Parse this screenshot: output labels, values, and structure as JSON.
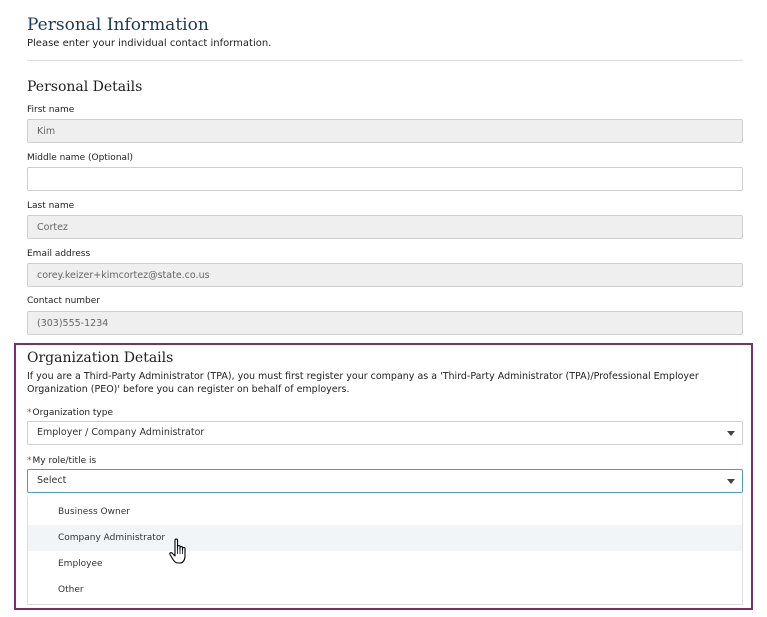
{
  "header": {
    "title": "Personal Information",
    "subtitle": "Please enter your individual contact information."
  },
  "personal": {
    "heading": "Personal Details",
    "first_name": {
      "label": "First name",
      "value": "Kim"
    },
    "middle_name": {
      "label": "Middle name (Optional)",
      "value": ""
    },
    "last_name": {
      "label": "Last name",
      "value": "Cortez"
    },
    "email": {
      "label": "Email address",
      "value": "corey.keizer+kimcortez@state.co.us"
    },
    "contact": {
      "label": "Contact number",
      "value": "(303)555-1234"
    }
  },
  "organization": {
    "heading": "Organization Details",
    "description": "If you are a Third-Party Administrator (TPA), you must first register your company as a 'Third-Party Administrator (TPA)/Professional Employer Organization (PEO)' before you can register on behalf of employers.",
    "required_marker": "*",
    "org_type": {
      "label": "Organization type",
      "value": "Employer / Company Administrator"
    },
    "role": {
      "label": "My role/title is",
      "value": "Select",
      "options": [
        "Business Owner",
        "Company Administrator",
        "Employee",
        "Other"
      ],
      "hovered_option": "Company Administrator"
    },
    "highlight_color": "#7b2d6c"
  },
  "icons": {
    "dropdown_caret": "chevron-down-icon",
    "cursor": "hand-pointer-icon"
  }
}
